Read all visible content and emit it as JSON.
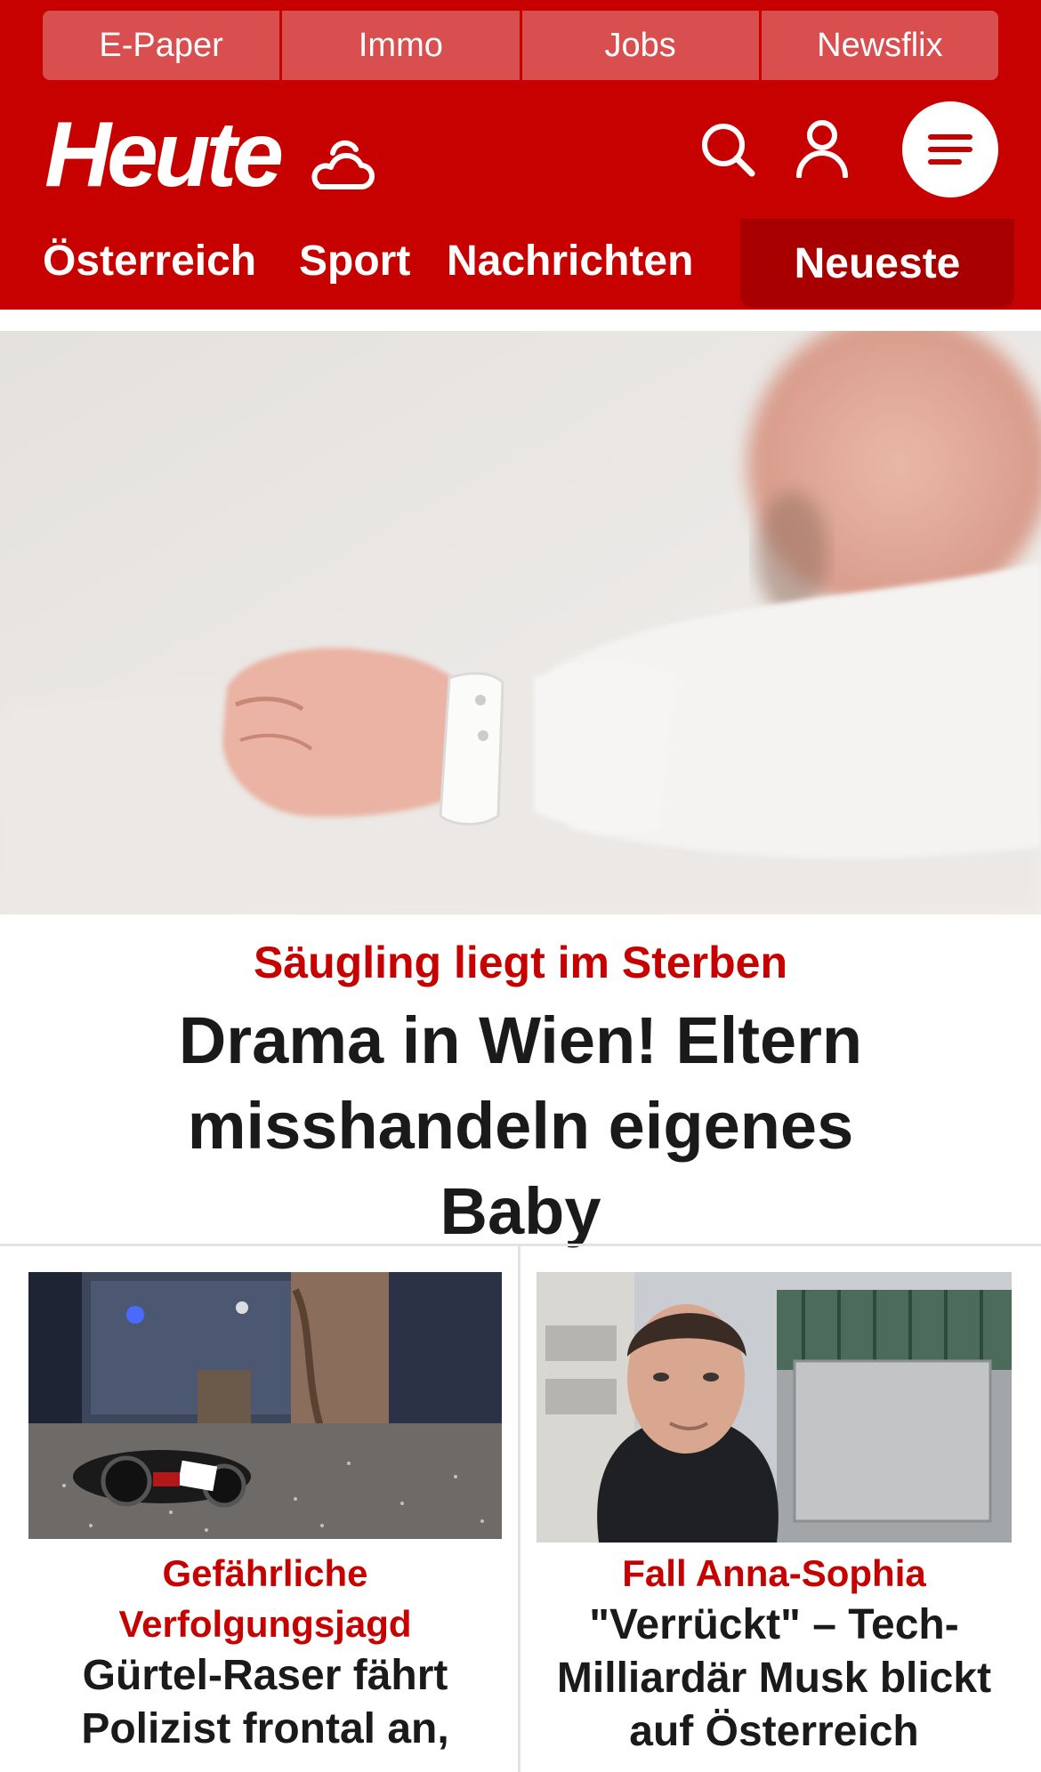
{
  "top_links": [
    "E-Paper",
    "Immo",
    "Jobs",
    "Newsflix"
  ],
  "brand": {
    "logo_text": "Heute"
  },
  "icons": {
    "weather": "cloud-sun-icon",
    "search": "search-icon",
    "account": "user-icon",
    "menu": "hamburger-menu-icon"
  },
  "nav": {
    "items": [
      "Österreich",
      "Sport",
      "Nachrichten"
    ],
    "highlight": "Neueste"
  },
  "hero": {
    "kicker": "Säugling liegt im Sterben",
    "headline": "Drama in Wien! Eltern misshandeln eigenes Baby"
  },
  "cards": [
    {
      "kicker": "Gefährliche Verfolgungsjagd",
      "title": "Gürtel-Raser fährt Polizist frontal an,"
    },
    {
      "kicker": "Fall Anna-Sophia",
      "title": "\"Verrückt\" – Tech-Milliardär Musk blickt auf Österreich"
    }
  ],
  "colors": {
    "brand_red": "#c70000",
    "dark_red": "#a80000",
    "text": "#1a1a1a"
  }
}
